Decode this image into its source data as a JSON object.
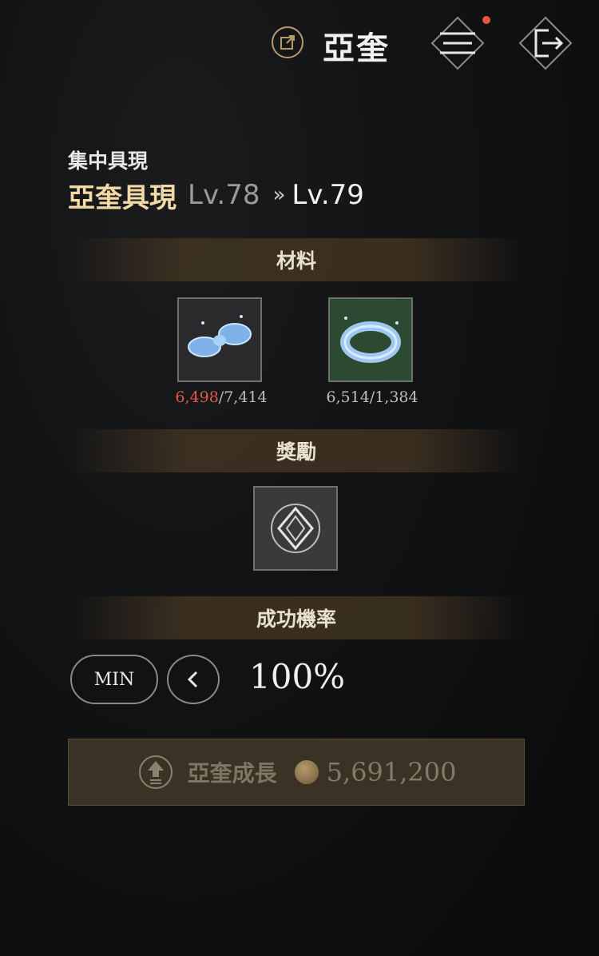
{
  "header": {
    "title": "亞奎"
  },
  "subtitle": "集中具現",
  "level": {
    "skill_name": "亞奎具現",
    "current": "Lv.78",
    "arrow": "»",
    "next": "Lv.79"
  },
  "sections": {
    "materials": "材料",
    "reward": "獎勵",
    "success_rate": "成功機率"
  },
  "materials": [
    {
      "owned": "6,498",
      "required": "/7,414"
    },
    {
      "owned": "6,514",
      "required": "/1,384"
    }
  ],
  "rate": {
    "min_label": "MIN",
    "value": "100%"
  },
  "grow_button": {
    "label": "亞奎成長",
    "cost": "5,691,200"
  },
  "colors": {
    "accent_gold": "#f2d9a6",
    "insufficient_red": "#e05a4e",
    "notification_dot": "#e8553a"
  }
}
